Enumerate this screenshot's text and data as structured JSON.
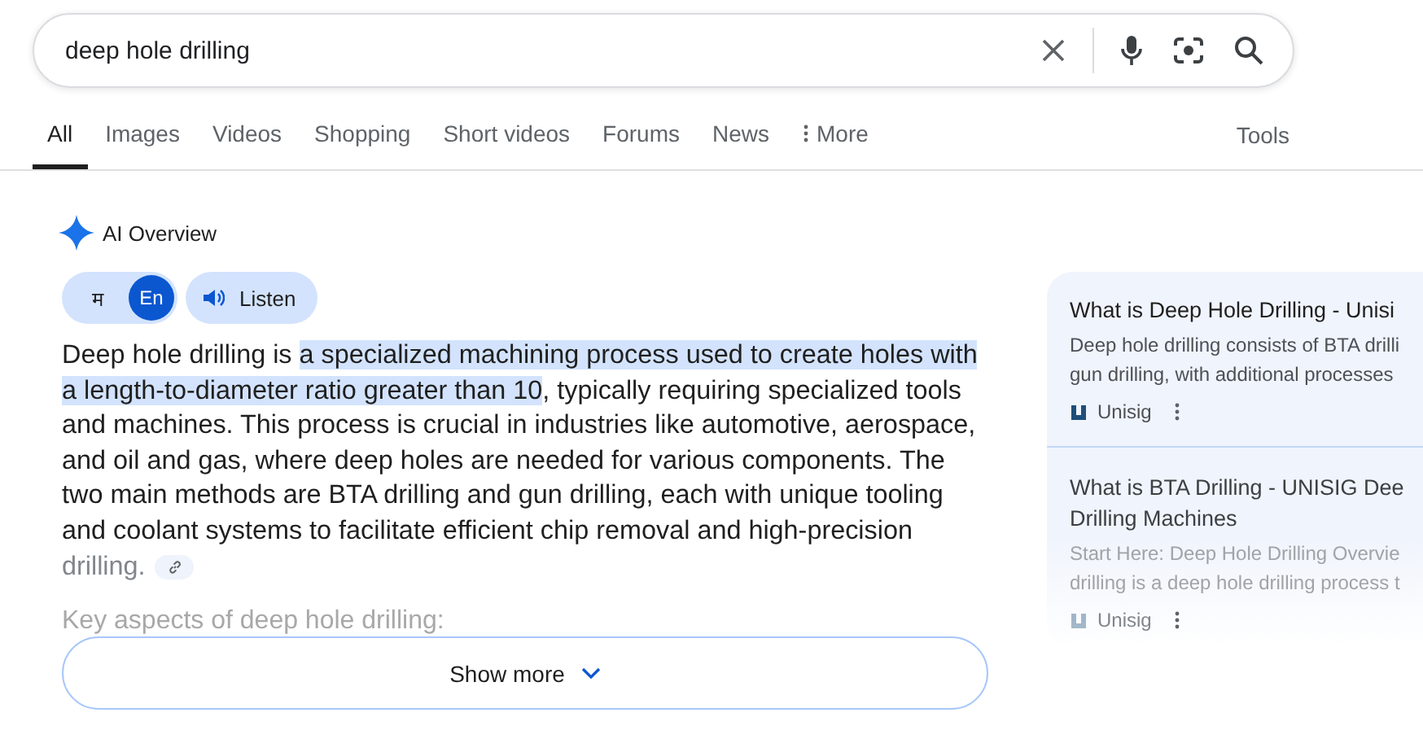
{
  "search": {
    "value": "deep hole drilling"
  },
  "tabs": [
    {
      "label": "All",
      "selected": true
    },
    {
      "label": "Images",
      "selected": false
    },
    {
      "label": "Videos",
      "selected": false
    },
    {
      "label": "Shopping",
      "selected": false
    },
    {
      "label": "Short videos",
      "selected": false
    },
    {
      "label": "Forums",
      "selected": false
    },
    {
      "label": "News",
      "selected": false
    },
    {
      "label": "More",
      "selected": false,
      "kind": "menu"
    }
  ],
  "tools": "Tools",
  "overview": {
    "title": "AI Overview",
    "languages": [
      {
        "label": "म",
        "selected": false
      },
      {
        "label": "En",
        "selected": true
      }
    ],
    "listen": "Listen",
    "paragraph": {
      "lead": "Deep hole drilling is ",
      "highlighted": "a specialized machining process used to create holes with a length-to-diameter ratio greater than 10",
      "rest": ", typically requiring specialized tools and machines. This process is crucial in industries like automotive, aerospace, and oil and gas, where deep holes are needed for various components. The two main methods are BTA drilling and gun drilling, each with unique tooling and coolant systems to facilitate efficient chip removal and high-precision ",
      "faded_end": "drilling."
    },
    "faded_heading": "Key aspects of deep hole drilling:",
    "show_more": "Show more"
  },
  "sources": [
    {
      "title_lines": [
        "What is Deep Hole Drilling - Unisi"
      ],
      "snippet_lines": [
        "Deep hole drilling consists of BTA drilli",
        "gun drilling, with additional processes"
      ],
      "site": "Unisig",
      "faded": false
    },
    {
      "title_lines": [
        "What is BTA Drilling - UNISIG Dee",
        "Drilling Machines"
      ],
      "snippet_lines": [
        "Start Here: Deep Hole Drilling Overvie",
        "drilling is a deep hole drilling process t"
      ],
      "site": "Unisig",
      "faded": true
    }
  ]
}
